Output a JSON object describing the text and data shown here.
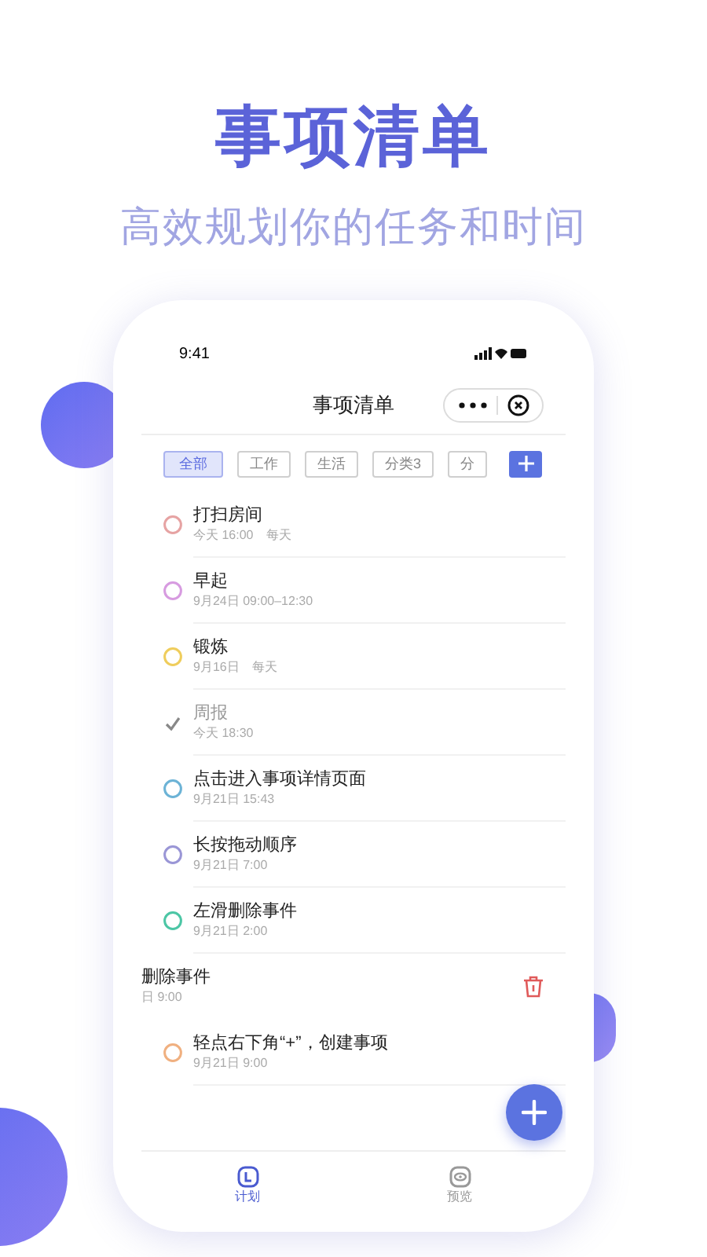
{
  "headline": "事项清单",
  "subtitle": "高效规划你的任务和时间",
  "phone": {
    "status_time": "9:41",
    "nav_title": "事项清单",
    "categories": [
      {
        "label": "全部",
        "selected": true
      },
      {
        "label": "工作",
        "selected": false
      },
      {
        "label": "生活",
        "selected": false
      },
      {
        "label": "分类3",
        "selected": false
      },
      {
        "label": "分",
        "selected": false
      }
    ],
    "tasks": [
      {
        "title": "打扫房间",
        "time": "今天 16:00",
        "repeat": "每天",
        "done": false,
        "swiped": false,
        "color": "#e6a3a3"
      },
      {
        "title": "早起",
        "time": "9月24日 09:00–12:30",
        "done": false,
        "swiped": false,
        "color": "#d79be0"
      },
      {
        "title": "锻炼",
        "time": "9月16日",
        "repeat": "每天",
        "done": false,
        "swiped": false,
        "color": "#efcd5c"
      },
      {
        "title": "周报",
        "time": "今天 18:30",
        "done": true,
        "swiped": false,
        "color": "#888888"
      },
      {
        "title": "点击进入事项详情页面",
        "time": "9月21日 15:43",
        "done": false,
        "swiped": false,
        "color": "#6cb3d6"
      },
      {
        "title": "长按拖动顺序",
        "time": "9月21日 7:00",
        "done": false,
        "swiped": false,
        "color": "#9a96d6"
      },
      {
        "title": "左滑删除事件",
        "time": "9月21日 2:00",
        "done": false,
        "swiped": false,
        "color": "#4cc6a5"
      },
      {
        "title": "删除事件",
        "time": "日 9:00",
        "swiped": true
      },
      {
        "title": "轻点右下角“+”，创建事项",
        "time": "9月21日 9:00",
        "done": false,
        "swiped": false,
        "color": "#f0b080"
      }
    ],
    "tabs": [
      {
        "label": "计划",
        "selected": true
      },
      {
        "label": "预览",
        "selected": false
      }
    ]
  }
}
